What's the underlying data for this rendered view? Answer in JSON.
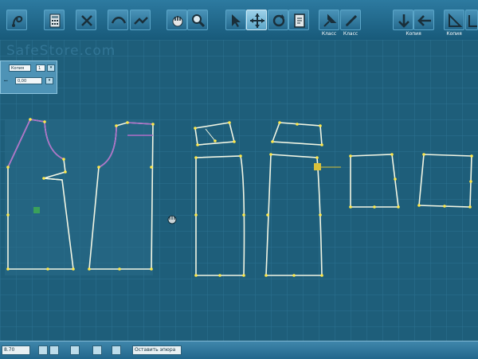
{
  "toolbar": {
    "buttons": [
      {
        "name": "curve-tool-icon"
      },
      {
        "name": "calculator-icon"
      },
      {
        "name": "scissors-icon"
      },
      {
        "name": "bezier-tool-icon"
      },
      {
        "name": "fold-tool-icon"
      },
      {
        "name": "hand-pan-icon"
      },
      {
        "name": "zoom-icon"
      },
      {
        "name": "select-arrow-icon"
      },
      {
        "name": "move-cross-icon",
        "active": true
      },
      {
        "name": "rotate-icon"
      },
      {
        "name": "page-icon"
      },
      {
        "name": "pin-klass-icon"
      },
      {
        "name": "pencil-klass-icon"
      },
      {
        "name": "arrow-down-icon"
      },
      {
        "name": "arrow-left-icon"
      },
      {
        "name": "angle-icon"
      },
      {
        "name": "angle2-icon"
      }
    ],
    "labels": {
      "klass1": "Класс",
      "klass2": "Класс",
      "kopiya1": "Копия",
      "kopiya2": "Копия"
    }
  },
  "watermark": "SafeStore.com",
  "panel": {
    "mode_label": "Копия",
    "count_value": "1",
    "step_value": "0,00"
  },
  "status": {
    "value": "8.70",
    "button_ok": "Оставить эпюра"
  },
  "colors": {
    "canvas_bg": "#1e5e7a",
    "grid_line": "#2c7291",
    "outline": "#f2f6e4",
    "seam": "#b06ec8",
    "point": "#ffe84a"
  }
}
